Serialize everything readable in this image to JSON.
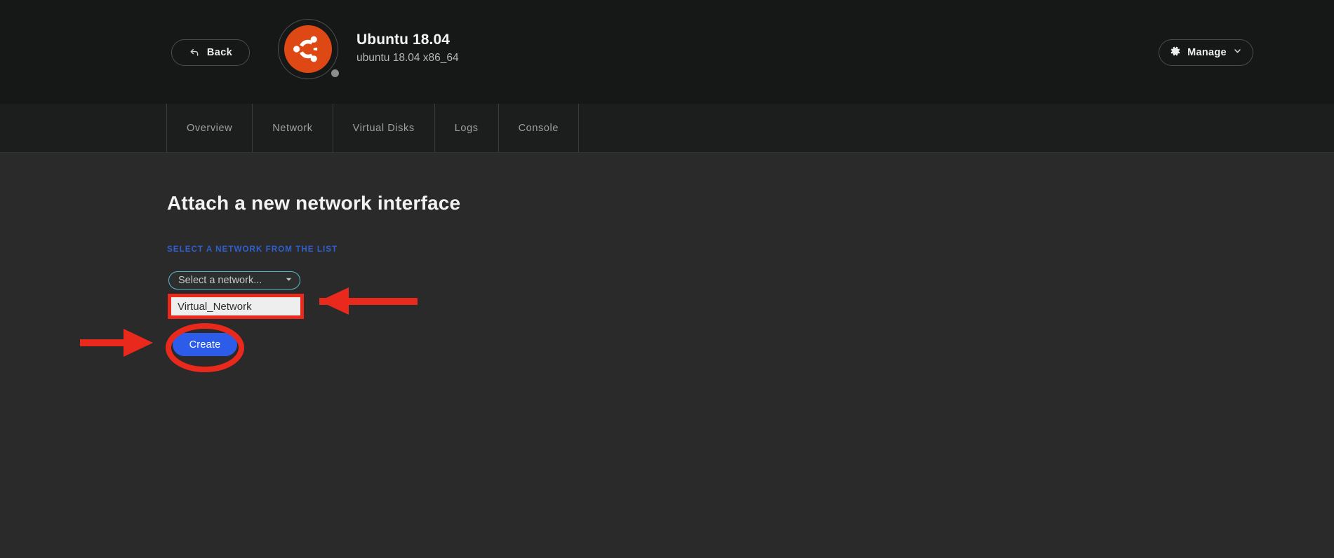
{
  "header": {
    "back_label": "Back",
    "back_icon": "back-arrow-icon",
    "os_title": "Ubuntu 18.04",
    "os_subtitle": "ubuntu 18.04 x86_64",
    "os_logo_icon": "ubuntu-logo-icon",
    "manage_label": "Manage",
    "manage_icon": "gear-icon",
    "manage_chevron_icon": "chevron-down-icon",
    "background_color": "#161817",
    "logo_color": "#dd4814"
  },
  "tabs": [
    {
      "label": "Overview"
    },
    {
      "label": "Network"
    },
    {
      "label": "Virtual Disks"
    },
    {
      "label": "Logs"
    },
    {
      "label": "Console"
    }
  ],
  "main": {
    "page_title": "Attach a new network interface",
    "field_label": "SELECT A NETWORK FROM THE LIST",
    "field_label_color": "#2f5fd0",
    "select": {
      "value": "Select a network...",
      "placeholder": "Select a network...",
      "caret_icon": "caret-down-icon",
      "border_color": "#59b7cf"
    },
    "dropdown": {
      "options": [
        {
          "label": "Virtual_Network",
          "highlighted": true
        }
      ]
    },
    "create_button": {
      "label": "Create",
      "color": "#2c5ce8"
    },
    "background_color": "#2a2a2a"
  },
  "annotations": {
    "highlight_color": "#e8291c",
    "items": [
      {
        "type": "arrow-left",
        "target": "dropdown-option"
      },
      {
        "type": "arrow-right",
        "target": "create-button"
      },
      {
        "type": "ellipse",
        "target": "create-button"
      },
      {
        "type": "rectangle",
        "target": "dropdown-option"
      }
    ]
  }
}
